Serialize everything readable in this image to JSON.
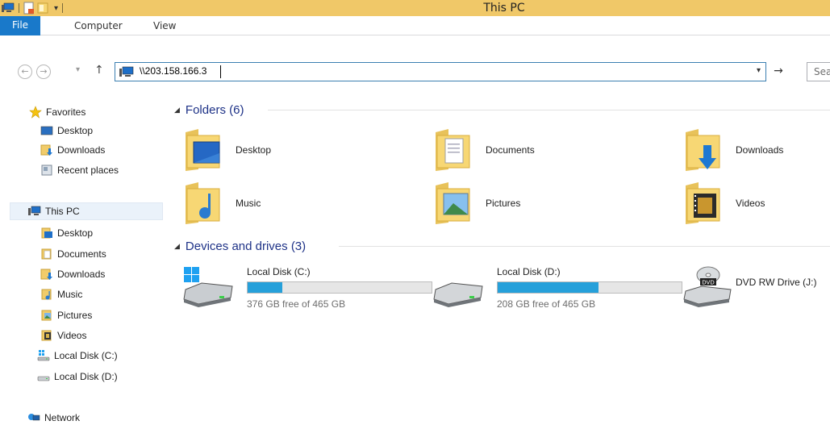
{
  "window": {
    "title": "This PC"
  },
  "ribbon": {
    "tabs": [
      "File",
      "Computer",
      "View"
    ]
  },
  "address": {
    "path": "\\\\203.158.166.3",
    "search_placeholder": "Sea"
  },
  "sidebar": {
    "favorites_label": "Favorites",
    "favorites": [
      "Desktop",
      "Downloads",
      "Recent places"
    ],
    "thispc_label": "This PC",
    "thispc": [
      "Desktop",
      "Documents",
      "Downloads",
      "Music",
      "Pictures",
      "Videos",
      "Local Disk (C:)",
      "Local Disk (D:)"
    ],
    "network_label": "Network"
  },
  "content": {
    "folders_header": "Folders (6)",
    "folders": [
      "Desktop",
      "Documents",
      "Downloads",
      "Music",
      "Pictures",
      "Videos"
    ],
    "devices_header": "Devices and drives (3)",
    "drives": [
      {
        "name": "Local Disk (C:)",
        "free": "376 GB free of 465 GB",
        "used_fraction": 0.19
      },
      {
        "name": "Local Disk (D:)",
        "free": "208 GB free of 465 GB",
        "used_fraction": 0.55
      },
      {
        "name": "DVD RW Drive (J:)"
      }
    ]
  },
  "colors": {
    "titlebar": "#f0c868",
    "file_tab": "#1979ca",
    "accent_bar": "#26a0da",
    "group_header": "#1e3287"
  }
}
